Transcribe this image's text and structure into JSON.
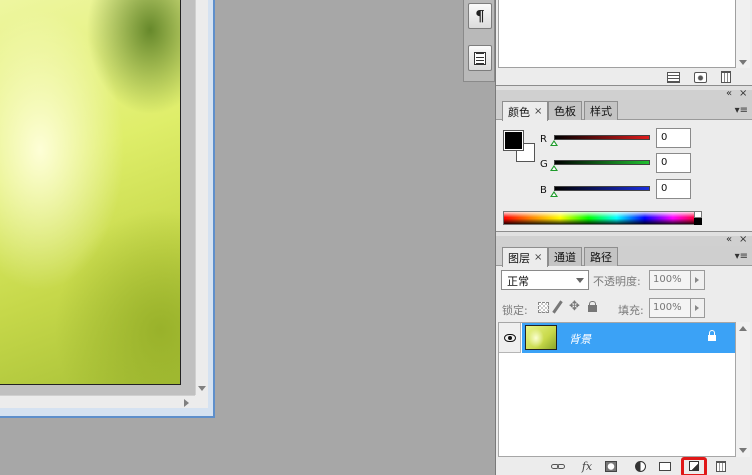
{
  "panels": {
    "color": {
      "tabs": [
        {
          "label": "颜色",
          "active": true,
          "close": "×"
        },
        {
          "label": "色板",
          "active": false
        },
        {
          "label": "样式",
          "active": false
        }
      ],
      "foreground": "#000000",
      "background": "#ffffff",
      "channels": [
        {
          "label": "R",
          "value": "0",
          "color": "#d42222"
        },
        {
          "label": "G",
          "value": "0",
          "color": "#22a32a"
        },
        {
          "label": "B",
          "value": "0",
          "color": "#2233c8"
        }
      ]
    },
    "layers": {
      "tabs": [
        {
          "label": "图层",
          "active": true,
          "close": "×"
        },
        {
          "label": "通道",
          "active": false
        },
        {
          "label": "路径",
          "active": false
        }
      ],
      "blend_mode": "正常",
      "opacity_label": "不透明度:",
      "opacity_value": "100%",
      "lock_label": "锁定:",
      "fill_label": "填充:",
      "fill_value": "100%",
      "layer_items": [
        {
          "name": "背景",
          "visible": true,
          "locked": true,
          "selected": true
        }
      ],
      "footer_labels": {
        "fx": "fx"
      }
    },
    "dock": {
      "paragraph_glyph": "¶"
    },
    "window_controls": {
      "collapse": "«",
      "close": "×",
      "menu": "▾≡"
    }
  },
  "colors": {
    "selection": "#3ba2f6",
    "highlight": "#e01818",
    "doc_border": "#5e8fcb"
  }
}
